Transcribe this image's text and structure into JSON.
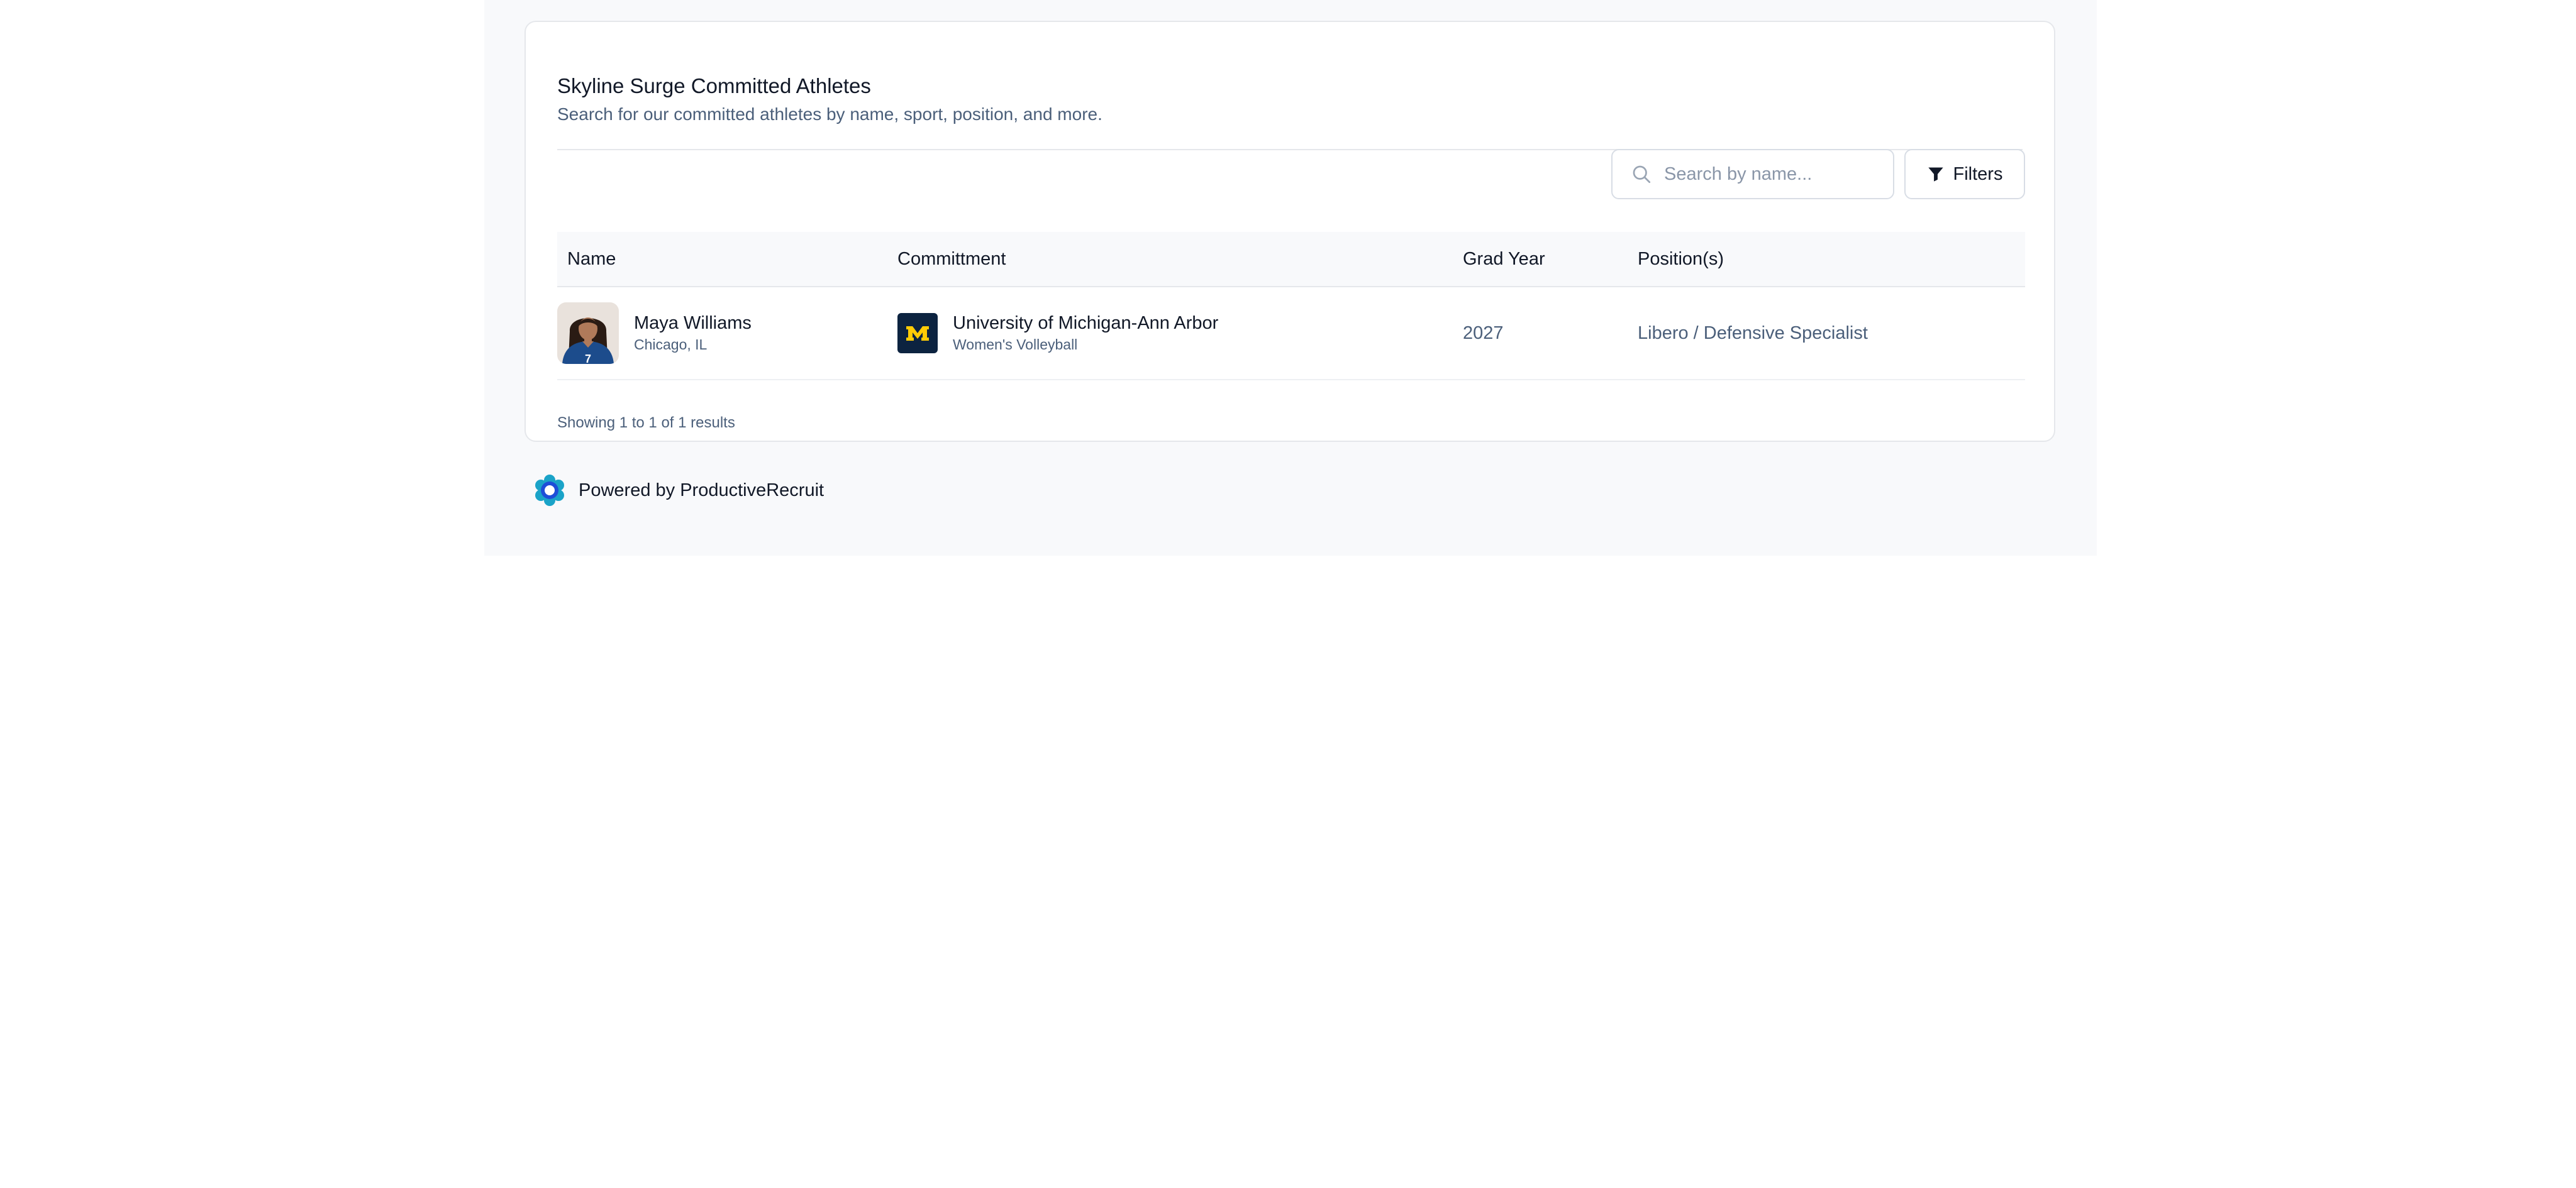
{
  "card": {
    "title": "Skyline Surge Committed Athletes",
    "subtitle": "Search for our committed athletes by name, sport, position, and more."
  },
  "toolbar": {
    "search_placeholder": "Search by name...",
    "search_value": "",
    "filters_label": "Filters"
  },
  "table": {
    "columns": [
      "Name",
      "Committment",
      "Grad Year",
      "Position(s)"
    ],
    "rows": [
      {
        "name": "Maya Williams",
        "location": "Chicago, IL",
        "school": "University of Michigan-Ann Arbor",
        "sport": "Women's Volleyball",
        "grad_year": "2027",
        "positions": "Libero / Defensive Specialist",
        "jersey_number": "7"
      }
    ]
  },
  "results_text": "Showing 1 to 1 of 1 results",
  "footer": {
    "text": "Powered by ProductiveRecruit"
  },
  "colors": {
    "page_bg": "#ffffff",
    "frame_bg": "#f8f9fb",
    "muted_text": "#4b5f7a",
    "michigan_blue": "#0c2340",
    "michigan_maize": "#ffcb05",
    "brand_teal": "#1aa3c8"
  },
  "icons": {
    "search": "search-icon",
    "filter": "filter-icon",
    "logo": "michigan-m-logo",
    "brand": "productiverecruit-logo-icon"
  }
}
